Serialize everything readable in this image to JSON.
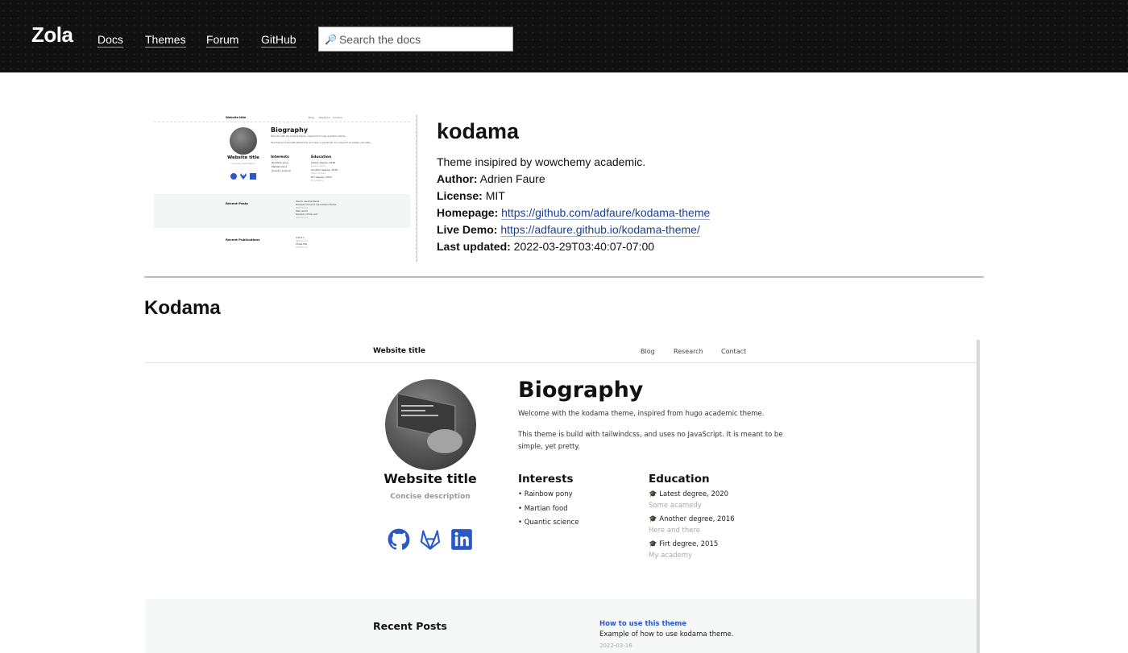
{
  "header": {
    "logo": "Zola",
    "nav": [
      "Docs",
      "Themes",
      "Forum",
      "GitHub"
    ],
    "search_placeholder": "Search the docs"
  },
  "theme": {
    "name": "kodama",
    "description": "Theme insipired by wowchemy academic.",
    "author_label": "Author:",
    "author": "Adrien Faure",
    "license_label": "License:",
    "license": "MIT",
    "homepage_label": "Homepage:",
    "homepage": "https://github.com/adfaure/kodama-theme",
    "demo_label": "Live Demo:",
    "demo": "https://adfaure.github.io/kodama-theme/",
    "updated_label": "Last updated:",
    "updated": "2022-03-29T03:40:07-07:00"
  },
  "readme": {
    "title": "Kodama"
  },
  "preview": {
    "site_title": "Website title",
    "nav": [
      "Blog",
      "Research",
      "Contact"
    ],
    "name": "Website title",
    "tagline": "Concise description",
    "heading": "Biography",
    "para1": "Welcome with the kodama theme, inspired from hugo academic theme.",
    "para2": "This theme is build with tailwindcss, and uses no JavaScript. It is meant to be simple, yet pretty.",
    "interests_title": "Interests",
    "interests": [
      "Rainbow pony",
      "Martian food",
      "Quantic science"
    ],
    "education_title": "Education",
    "education": [
      {
        "degree": "Latest degree, 2020",
        "school": "Some acamedy"
      },
      {
        "degree": "Another degree, 2016",
        "school": "Here and there"
      },
      {
        "degree": "Firt degree, 2015",
        "school": "My academy"
      }
    ],
    "recent_posts_title": "Recent Posts",
    "post": {
      "title": "How to use this theme",
      "summary": "Example of how to use kodama theme.",
      "date": "2022-03-16"
    },
    "icons": [
      "github-icon",
      "gitlab-icon",
      "linkedin-icon",
      "graduation-cap-icon"
    ]
  },
  "thumbnail": {
    "site_title": "Website title",
    "nav": [
      "Blog",
      "Research",
      "Contact"
    ],
    "heading": "Biography",
    "intro": "Welcome with the kodama theme, inspired from hugo academic theme.",
    "intro2": "This theme is build with tailwindcss, and uses no JavaScript. It is meant to be simple, yet pretty.",
    "name": "Website title",
    "tagline": "Concise description",
    "interests_title": "Interests",
    "interests": [
      "Rainbow pony",
      "Martian food",
      "Quantic science"
    ],
    "education_title": "Education",
    "education": [
      "Latest degree, 2020",
      "Another degree, 2016",
      "Firt degree, 2015"
    ],
    "education_sub": [
      "Some acamedy",
      "Here and there",
      "My academy"
    ],
    "recent_posts": "Recent Posts",
    "posts": [
      "How to use this theme",
      "Example of how to use kodama theme.",
      "2022-03-16",
      "Hello world",
      "Example of first post",
      "2022-03-14"
    ],
    "recent_pubs": "Recent Publications",
    "pubs": [
      "Article 1",
      "2022-03-14",
      "Thesis title",
      "2022-03-14"
    ]
  }
}
